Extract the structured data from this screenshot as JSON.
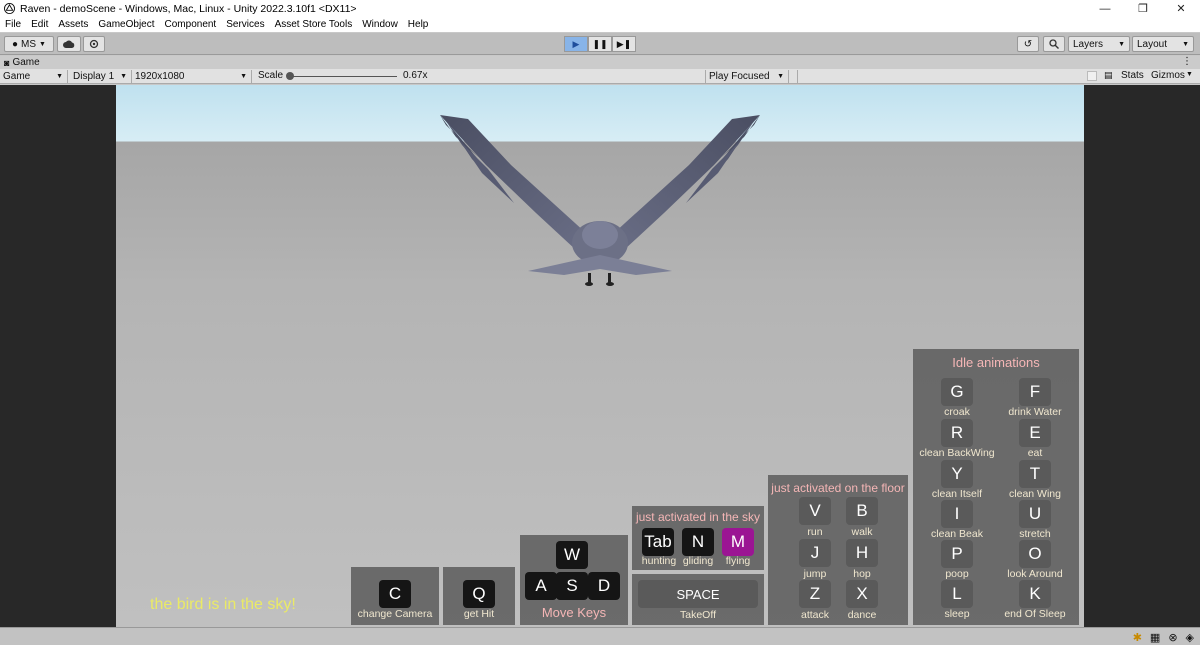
{
  "window": {
    "title": "Raven - demoScene - Windows, Mac, Linux - Unity 2022.3.10f1 <DX11>",
    "minimize": "—",
    "maximize": "❐",
    "close": "✕"
  },
  "menu": [
    "File",
    "Edit",
    "Assets",
    "GameObject",
    "Component",
    "Services",
    "Asset Store Tools",
    "Window",
    "Help"
  ],
  "toolbar": {
    "account": "MS",
    "cloud_icon": "cloud-icon",
    "collab_icon": "settings-icon",
    "layers": "Layers",
    "layout": "Layout"
  },
  "game_tab": {
    "label": "Game"
  },
  "game_controls": {
    "mode": "Game",
    "display": "Display 1",
    "resolution": "1920x1080",
    "scale_label": "Scale",
    "scale_value": "0.67x",
    "play_focused": "Play Focused",
    "stats": "Stats",
    "gizmos": "Gizmos"
  },
  "hud": {
    "status": "the bird is in the sky!",
    "camera": {
      "key": "C",
      "label": "change Camera"
    },
    "hit": {
      "key": "Q",
      "label": "get Hit"
    },
    "move": {
      "keys": [
        "W",
        "A",
        "S",
        "D"
      ],
      "label": "Move Keys"
    },
    "sky": {
      "title": "just activated in the sky",
      "keys": [
        {
          "key": "Tab",
          "label": "hunting"
        },
        {
          "key": "N",
          "label": "gliding"
        },
        {
          "key": "M",
          "label": "flying"
        }
      ]
    },
    "takeoff": {
      "key": "SPACE",
      "label": "TakeOff"
    },
    "floor": {
      "title": "just activated on the floor",
      "keys": [
        {
          "key": "V",
          "label": "run"
        },
        {
          "key": "B",
          "label": "walk"
        },
        {
          "key": "J",
          "label": "jump"
        },
        {
          "key": "H",
          "label": "hop"
        },
        {
          "key": "Z",
          "label": "attack"
        },
        {
          "key": "X",
          "label": "dance"
        }
      ]
    },
    "idle": {
      "title": "Idle animations",
      "keys": [
        {
          "key": "G",
          "label": "croak"
        },
        {
          "key": "F",
          "label": "drink Water"
        },
        {
          "key": "R",
          "label": "clean BackWing"
        },
        {
          "key": "E",
          "label": "eat"
        },
        {
          "key": "Y",
          "label": "clean Itself"
        },
        {
          "key": "T",
          "label": "clean Wing"
        },
        {
          "key": "I",
          "label": "clean Beak"
        },
        {
          "key": "U",
          "label": "stretch"
        },
        {
          "key": "P",
          "label": "poop"
        },
        {
          "key": "O",
          "label": "look Around"
        },
        {
          "key": "L",
          "label": "sleep"
        },
        {
          "key": "K",
          "label": "end Of Sleep"
        }
      ]
    }
  }
}
